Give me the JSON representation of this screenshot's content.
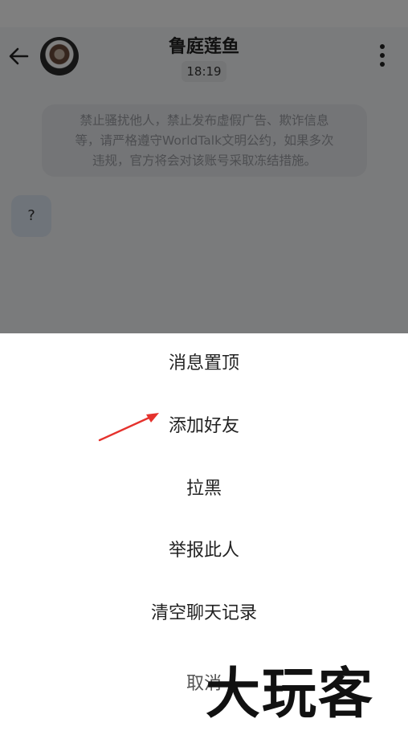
{
  "header": {
    "title": "鲁庭莲鱼",
    "time": "18:19",
    "back_icon": "arrow-left-icon",
    "more_icon": "vertical-dots-icon"
  },
  "chat": {
    "notice_lines": [
      "禁止骚扰他人，禁止发布虚假广告、欺诈信息",
      "等，请严格遵守WorldTalk文明公约，如果多次",
      "违规，官方将会对该账号采取冻结措施。"
    ],
    "message": "?"
  },
  "sheet": {
    "items": [
      "消息置顶",
      "添加好友",
      "拉黑",
      "举报此人",
      "清空聊天记录",
      "取消"
    ]
  },
  "watermark": "大玩客",
  "colors": {
    "overlay": "rgba(0,0,0,0.5)",
    "arrow": "#e5322d"
  }
}
